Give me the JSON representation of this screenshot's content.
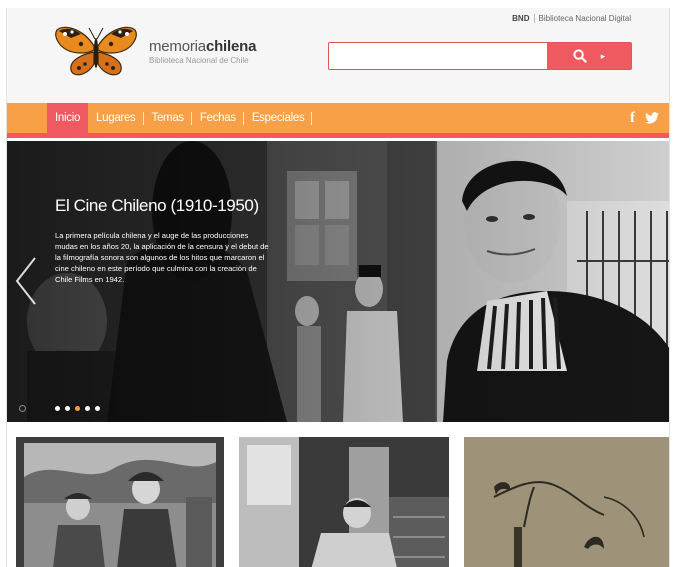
{
  "header": {
    "bnd_abbr": "BND",
    "bnd_full": "Biblioteca Nacional Digital",
    "logo_title_light": "memoria",
    "logo_title_bold": "chilena",
    "logo_subtitle": "Biblioteca Nacional de Chile"
  },
  "search": {
    "value": "",
    "placeholder": ""
  },
  "nav": {
    "items": [
      {
        "label": "Inicio"
      },
      {
        "label": "Lugares"
      },
      {
        "label": "Temas"
      },
      {
        "label": "Fechas"
      },
      {
        "label": "Especiales"
      }
    ],
    "social": {
      "facebook": "f"
    }
  },
  "hero": {
    "title": "El Cine Chileno (1910-1950)",
    "description": "La primera película chilena y el auge de las producciones mudas en los años 20, la aplicación de la censura y el debut de la filmografía sonora son algunos de los hitos que marcaron el cine chileno en este período que culmina con la creación de Chile Films en 1942.",
    "slide_count": 5,
    "active_slide": 3
  },
  "colors": {
    "nav_orange": "#f7a048",
    "accent_red": "#ee5a5f",
    "header_bg": "#f6f6f6"
  },
  "icons": {
    "logo": "butterfly-icon",
    "search": "search-icon",
    "search_caret": "caret-right-icon",
    "twitter": "twitter-icon",
    "hero_prev": "chevron-left-icon",
    "pause": "pause-icon"
  }
}
